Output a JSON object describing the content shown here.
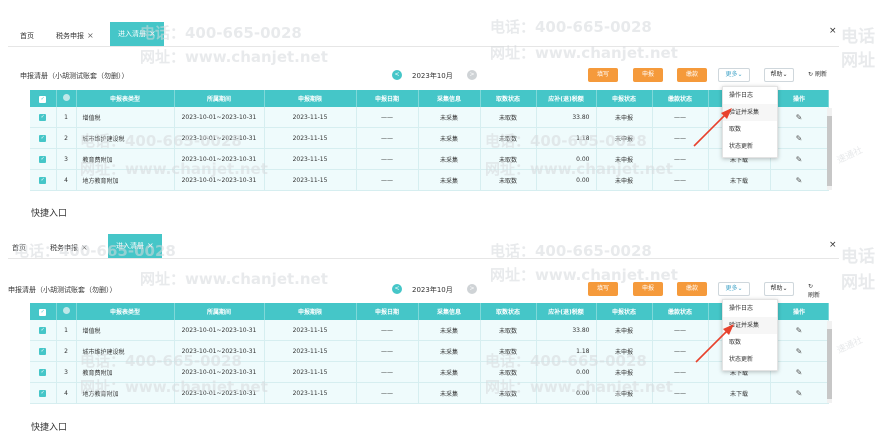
{
  "tabs": {
    "home": "首页",
    "tax": "税务申报",
    "active": "进入清册",
    "close_glyph": "×",
    "close_all": "×"
  },
  "toolbar": {
    "title": "申报清册（小胡测试账套（勿删））",
    "month": "2023年10月",
    "prev_glyph": "<",
    "next_glyph": ">",
    "fill": "填写",
    "declare": "申报",
    "pay": "缴款",
    "more": "更多",
    "help": "帮助",
    "refresh": "刷新"
  },
  "table": {
    "headers": [
      "申报表类型",
      "所属期间",
      "申报期限",
      "申报日期",
      "采集信息",
      "取数状态",
      "应补(退)税额",
      "申报状态",
      "缴款状态",
      "操作"
    ],
    "rows": [
      {
        "no": "1",
        "type": "增值税",
        "period": "2023-10-01~2023-10-31",
        "deadline": "2023-11-15",
        "date": "——",
        "collect": "未采集",
        "fetch": "未取数",
        "amount": "33.80",
        "declare": "未申报",
        "pay": "——",
        "status": "",
        "op": "✎"
      },
      {
        "no": "2",
        "type": "城市维护建设税",
        "period": "2023-10-01~2023-10-31",
        "deadline": "2023-11-15",
        "date": "——",
        "collect": "未采集",
        "fetch": "未取数",
        "amount": "1.18",
        "declare": "未申报",
        "pay": "——",
        "status": "",
        "op": "✎"
      },
      {
        "no": "3",
        "type": "教育费附加",
        "period": "2023-10-01~2023-10-31",
        "deadline": "2023-11-15",
        "date": "——",
        "collect": "未采集",
        "fetch": "未取数",
        "amount": "0.00",
        "declare": "未申报",
        "pay": "——",
        "status": "未下载",
        "op": "✎"
      },
      {
        "no": "4",
        "type": "地方教育附加",
        "period": "2023-10-01~2023-10-31",
        "deadline": "2023-11-15",
        "date": "——",
        "collect": "未采集",
        "fetch": "未取数",
        "amount": "0.00",
        "declare": "未申报",
        "pay": "——",
        "status": "未下载",
        "op": "✎"
      }
    ]
  },
  "dropdown": {
    "items": [
      "操作日志",
      "验证并采集",
      "取数",
      "状态更新"
    ]
  },
  "quick_entry": "快捷入口",
  "watermarks": {
    "phone": "电话：400-665-0028",
    "site": "网址：www.chanjet.net",
    "phone_short": "电话",
    "site_short": "网址",
    "seal": "速通社"
  },
  "colors": {
    "accent": "#45c6c8",
    "orange": "#f59a3b",
    "arrow": "#e8412c"
  }
}
